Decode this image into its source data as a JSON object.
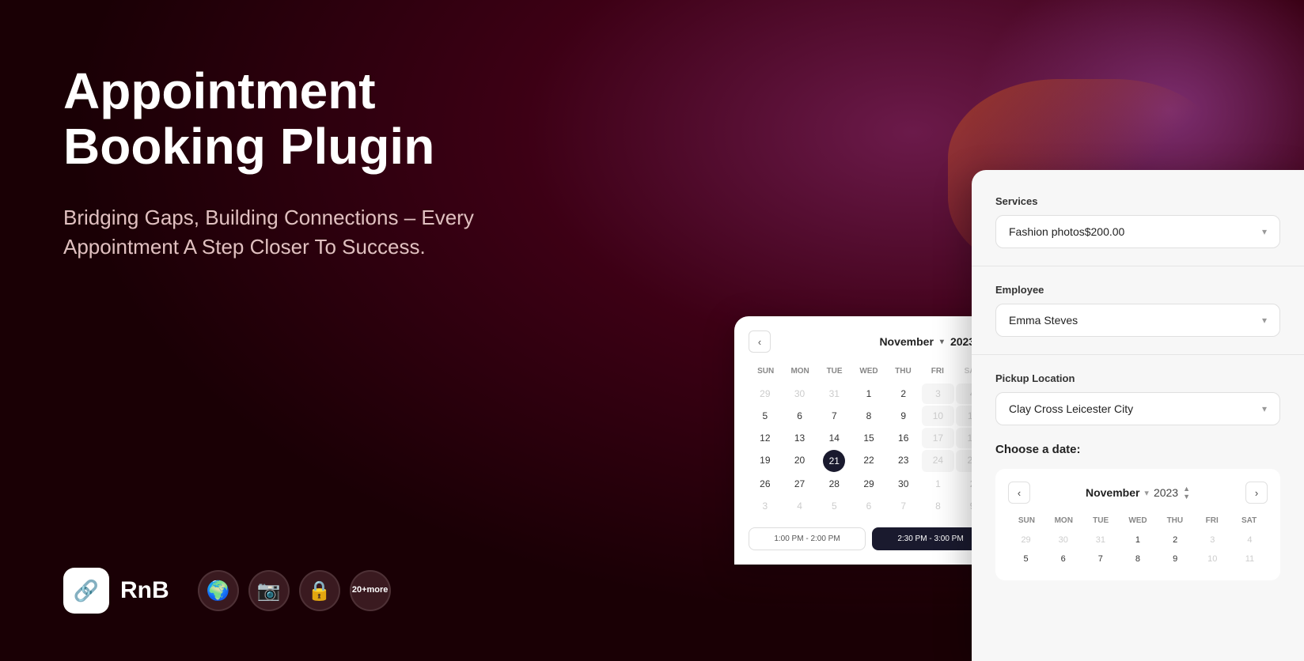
{
  "hero": {
    "title": "Appointment Booking Plugin",
    "subtitle": "Bridging Gaps, Building Connections – Every Appointment A Step Closer To Success."
  },
  "brand": {
    "name": "RnB",
    "icon": "🔗"
  },
  "plugins": [
    {
      "icon": "🌍",
      "label": "globe-plugin"
    },
    {
      "icon": "📷",
      "label": "camera-plugin"
    },
    {
      "icon": "🔒",
      "label": "lock-plugin"
    }
  ],
  "more_plugins": {
    "label": "20+",
    "sublabel": "more"
  },
  "booking": {
    "services_label": "Services",
    "services_value": "Fashion photos$200.00",
    "employee_label": "Employee",
    "employee_value": "Emma Steves",
    "pickup_label": "Pickup Location",
    "pickup_value": "Clay Cross Leicester City",
    "date_label": "Choose a date:",
    "month": "November",
    "year": "2023",
    "days_header": [
      "SUN",
      "MON",
      "TUE",
      "WED",
      "THU",
      "FRI",
      "SAT"
    ],
    "weeks": [
      [
        {
          "day": "29",
          "state": "other"
        },
        {
          "day": "30",
          "state": "other"
        },
        {
          "day": "31",
          "state": "other"
        },
        {
          "day": "1",
          "state": "normal"
        },
        {
          "day": "2",
          "state": "normal"
        },
        {
          "day": "3",
          "state": "normal"
        },
        {
          "day": "4",
          "state": "normal"
        }
      ],
      [
        {
          "day": "5",
          "state": "normal"
        },
        {
          "day": "6",
          "state": "normal"
        },
        {
          "day": "7",
          "state": "normal"
        },
        {
          "day": "8",
          "state": "normal"
        },
        {
          "day": "9",
          "state": "normal"
        },
        {
          "day": "10",
          "state": "normal"
        },
        {
          "day": "11",
          "state": "normal"
        }
      ]
    ]
  },
  "back_calendar": {
    "month": "November",
    "year": "2023",
    "days_header": [
      "SUN",
      "MON",
      "TUE",
      "WED",
      "THU",
      "FRI"
    ],
    "weeks": [
      [
        "29",
        "30",
        "31",
        "1",
        "2",
        "3"
      ],
      [
        "5",
        "6",
        "7",
        "8",
        "9",
        "10"
      ],
      [
        "12",
        "13",
        "14",
        "15",
        "16",
        "17"
      ],
      [
        "19",
        "20",
        "21",
        "22",
        "23",
        "24"
      ],
      [
        "26",
        "27",
        "28",
        "29",
        "30",
        "1"
      ],
      [
        "3",
        "4",
        "5",
        "6",
        "7",
        "8"
      ]
    ],
    "selected": "21",
    "time_slots": [
      {
        "time": "1:00 PM - 2:00 PM",
        "selected": false
      },
      {
        "time": "2:30 PM - 3:00 PM",
        "selected": true
      }
    ]
  }
}
